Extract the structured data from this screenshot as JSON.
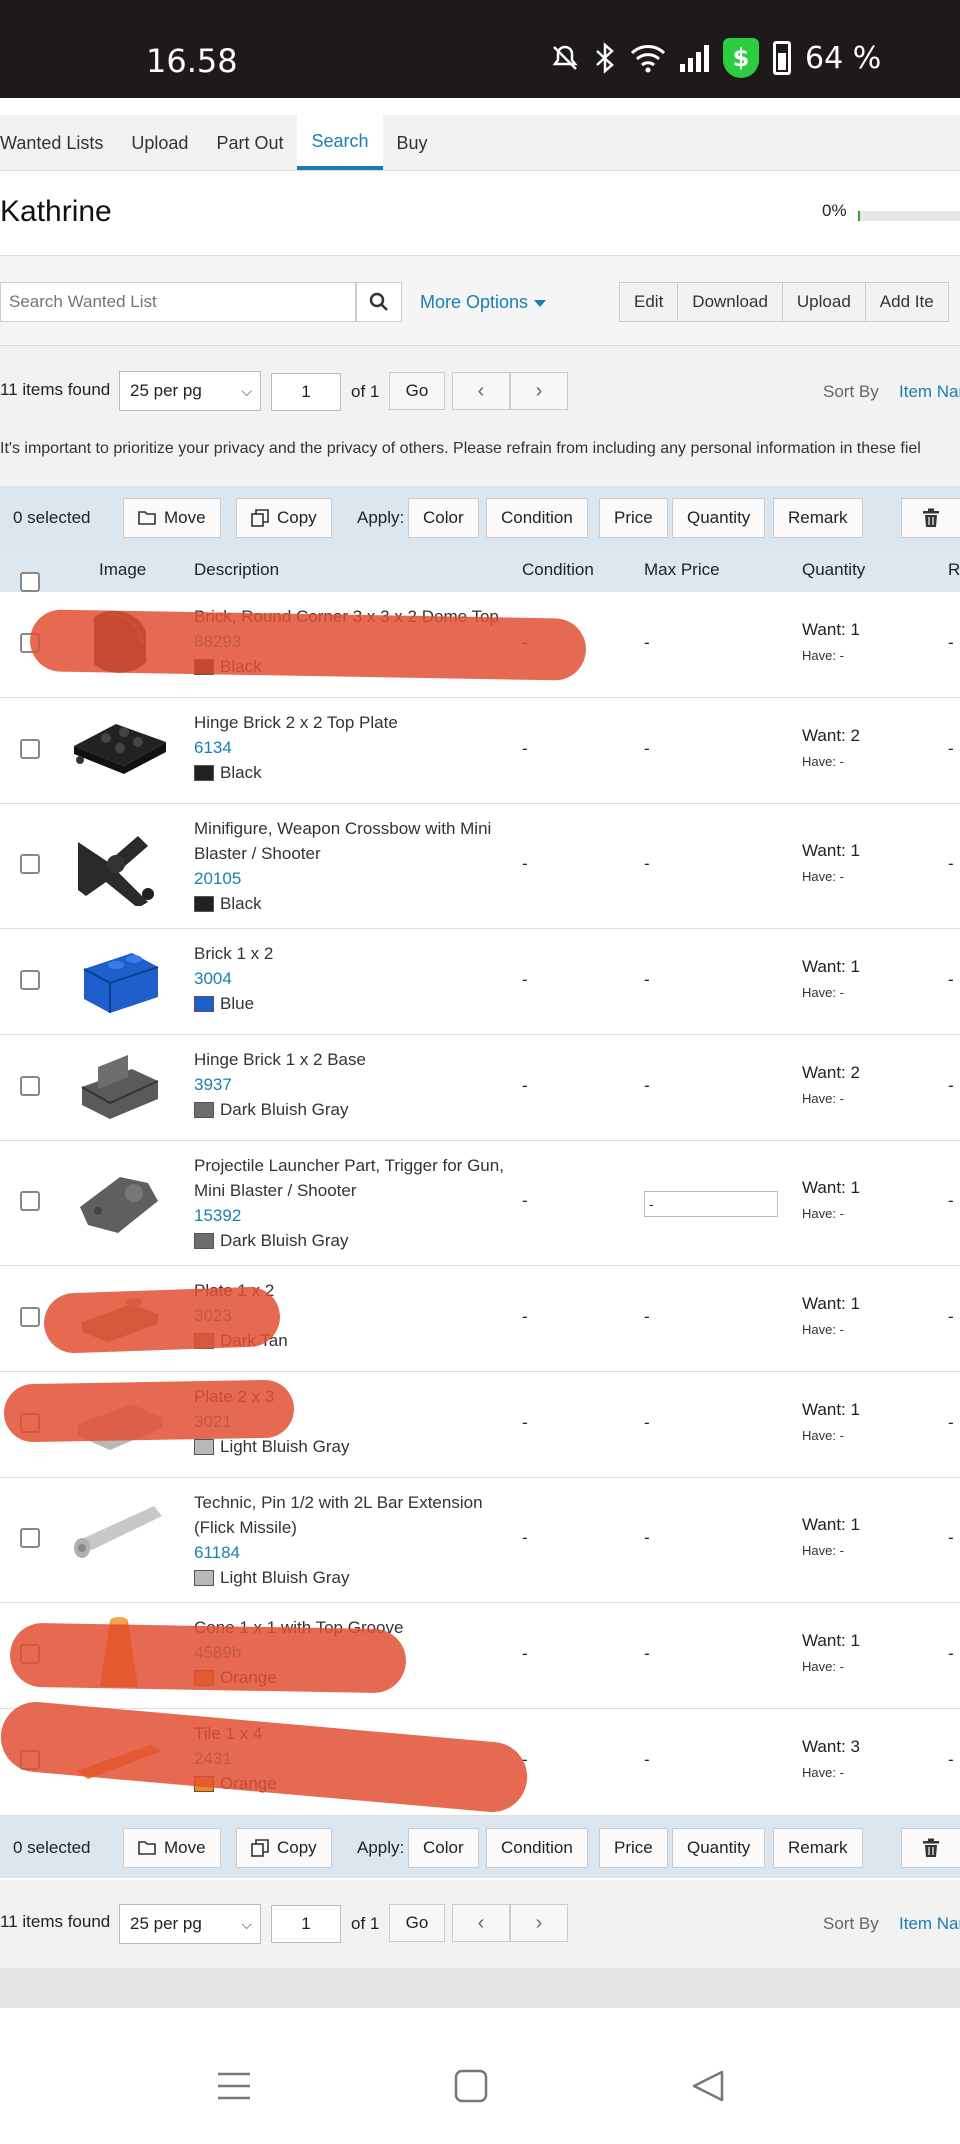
{
  "status_bar": {
    "time": "16.58",
    "battery": "64 %",
    "icons": [
      "mute-icon",
      "bluetooth-icon",
      "wifi-icon",
      "signal-icon",
      "shield-icon",
      "battery-icon"
    ]
  },
  "tabs": [
    {
      "label": "Wanted Lists",
      "active": false
    },
    {
      "label": "Upload",
      "active": false
    },
    {
      "label": "Part Out",
      "active": false
    },
    {
      "label": "Search",
      "active": true
    },
    {
      "label": "Buy",
      "active": false
    }
  ],
  "list": {
    "title": "Kathrine",
    "progress_text": "0%",
    "progress": 0
  },
  "toolbar": {
    "search_placeholder": "Search Wanted List",
    "more_options": "More Options",
    "buttons": [
      "Edit",
      "Download",
      "Upload",
      "Add Ite"
    ]
  },
  "pager": {
    "found": "11 items found",
    "per_page": "25 per pg",
    "page": "1",
    "of": "of 1",
    "go": "Go",
    "prev": "‹",
    "next": "›",
    "sort_label": "Sort By",
    "sort_value": "Item Nar"
  },
  "notice": "It's important to prioritize your privacy and the privacy of others. Please refrain from including any personal information in these fiel",
  "actions": {
    "selected": "0 selected",
    "move": "Move",
    "copy": "Copy",
    "apply": "Apply:",
    "apply_buttons": [
      "Color",
      "Condition",
      "Price",
      "Quantity",
      "Remark"
    ]
  },
  "table": {
    "headers": {
      "image": "Image",
      "description": "Description",
      "condition": "Condition",
      "max_price": "Max Price",
      "quantity": "Quantity",
      "remark": "R"
    },
    "rows": [
      {
        "name": "Brick, Round Corner 3 x 3 x 2 Dome Top",
        "id": "88293",
        "color": "Black",
        "swatch": "#222222",
        "condition": "-",
        "max_price": "-",
        "want": "Want: 1",
        "have": "Have: -",
        "remark": "-"
      },
      {
        "name": "Hinge Brick 2 x 2 Top Plate",
        "id": "6134",
        "color": "Black",
        "swatch": "#222222",
        "condition": "-",
        "max_price": "-",
        "want": "Want: 2",
        "have": "Have: -",
        "remark": "-"
      },
      {
        "name": "Minifigure, Weapon Crossbow with Mini Blaster / Shooter",
        "id": "20105",
        "color": "Black",
        "swatch": "#222222",
        "condition": "-",
        "max_price": "-",
        "want": "Want: 1",
        "have": "Have: -",
        "remark": "-"
      },
      {
        "name": "Brick 1 x 2",
        "id": "3004",
        "color": "Blue",
        "swatch": "#1f5fcc",
        "condition": "-",
        "max_price": "-",
        "want": "Want: 1",
        "have": "Have: -",
        "remark": "-"
      },
      {
        "name": "Hinge Brick 1 x 2 Base",
        "id": "3937",
        "color": "Dark Bluish Gray",
        "swatch": "#6e6e6e",
        "condition": "-",
        "max_price": "-",
        "want": "Want: 2",
        "have": "Have: -",
        "remark": "-"
      },
      {
        "name": "Projectile Launcher Part, Trigger for Gun, Mini Blaster / Shooter",
        "id": "15392",
        "color": "Dark Bluish Gray",
        "swatch": "#6e6e6e",
        "condition": "-",
        "max_price": "-",
        "want": "Want: 1",
        "have": "Have: -",
        "remark": "-"
      },
      {
        "name": "Plate 1 x 2",
        "id": "3023",
        "color": "Dark Tan",
        "swatch": "#9b8560",
        "condition": "-",
        "max_price": "-",
        "want": "Want: 1",
        "have": "Have: -",
        "remark": "-"
      },
      {
        "name": "Plate 2 x 3",
        "id": "3021",
        "color": "Light Bluish Gray",
        "swatch": "#b8b8b8",
        "condition": "-",
        "max_price": "-",
        "want": "Want: 1",
        "have": "Have: -",
        "remark": "-"
      },
      {
        "name": "Technic, Pin 1/2 with 2L Bar Extension (Flick Missile)",
        "id": "61184",
        "color": "Light Bluish Gray",
        "swatch": "#b8b8b8",
        "condition": "-",
        "max_price": "-",
        "want": "Want: 1",
        "have": "Have: -",
        "remark": "-"
      },
      {
        "name": "Cone 1 x 1 with Top Groove",
        "id": "4589b",
        "color": "Orange",
        "swatch": "#f28a1e",
        "condition": "-",
        "max_price": "-",
        "want": "Want: 1",
        "have": "Have: -",
        "remark": "-"
      },
      {
        "name": "Tile 1 x 4",
        "id": "2431",
        "color": "Orange",
        "swatch": "#f28a1e",
        "condition": "-",
        "max_price": "-",
        "want": "Want: 3",
        "have": "Have: -",
        "remark": "-"
      }
    ]
  },
  "nav": {
    "icons": [
      "menu-icon",
      "home-square-icon",
      "back-triangle-icon"
    ]
  },
  "colors": {
    "accent": "#1a7fb0",
    "redaction": "#e25034",
    "header_bg": "#dde7ef"
  }
}
